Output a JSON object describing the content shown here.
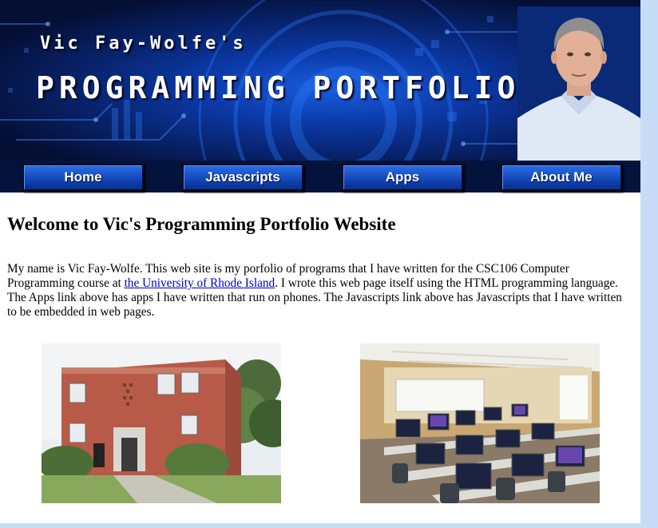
{
  "banner": {
    "owner": "Vic Fay-Wolfe's",
    "title": "PROGRAMMING PORTFOLIO",
    "portrait_icon": "person-portrait"
  },
  "nav": {
    "items": [
      {
        "label": "Home"
      },
      {
        "label": "Javascripts"
      },
      {
        "label": "Apps"
      },
      {
        "label": "About Me"
      }
    ]
  },
  "main": {
    "heading": "Welcome to Vic's Programming Portfolio Website",
    "intro_part1": "My name is Vic Fay-Wolfe. This web site is my porfolio of programs that I have written for the CSC106 Computer Programming course at ",
    "intro_link": "the University of Rhode Island",
    "intro_part2": ". I wrote this web page itself using the HTML programming language. The Apps link above has apps I have written that run on phones. The Javascripts link above has Javascripts that I have written to be embedded in web pages."
  },
  "colors": {
    "banner_blue": "#0b3aa8",
    "nav_bg": "#04133b",
    "link": "#0000cc",
    "outer_bg": "#c6dcf7"
  }
}
